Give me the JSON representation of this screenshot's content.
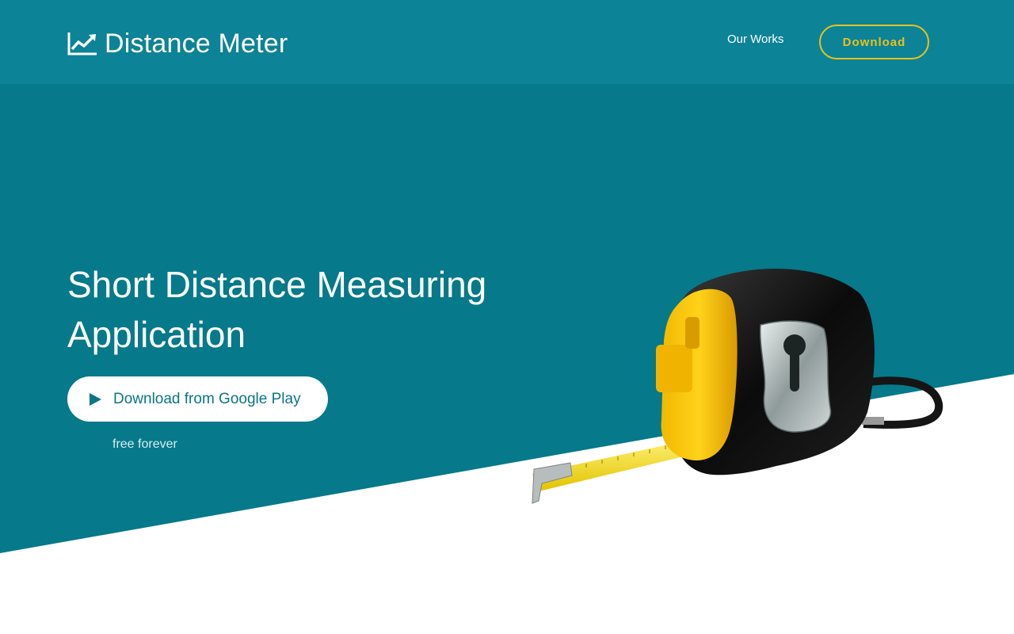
{
  "colors": {
    "nav_bg": "#0d8397",
    "hero_bg": "#06798a",
    "accent": "#e6c21f",
    "button_text": "#0a7587",
    "white": "#ffffff"
  },
  "navbar": {
    "brand_icon": "chart-line-icon",
    "brand_name": "Distance Meter",
    "links": [
      {
        "label": "Our Works"
      }
    ],
    "download_label": "Download"
  },
  "hero": {
    "title_line1": "Short Distance Measuring",
    "title_line2": "Application",
    "cta_icon": "play-icon",
    "cta_label": "Download from Google Play",
    "note": "free forever",
    "illustration": "tape-measure-illustration"
  }
}
